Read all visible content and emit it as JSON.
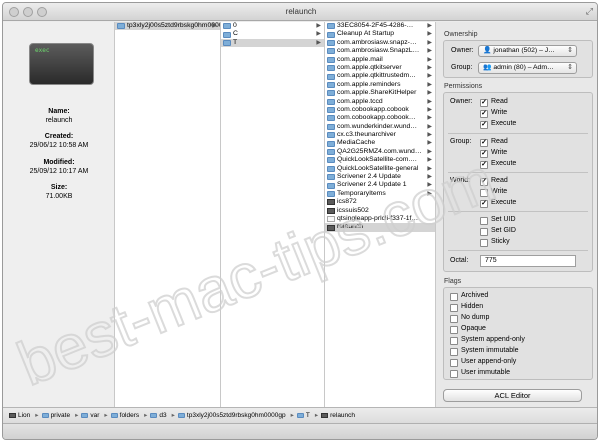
{
  "window": {
    "title": "relaunch"
  },
  "preview": {
    "icon_text": "exec",
    "name_label": "Name:",
    "name": "relaunch",
    "created_label": "Created:",
    "created": "29/06/12 10:58 AM",
    "modified_label": "Modified:",
    "modified": "25/09/12 10:17 AM",
    "size_label": "Size:",
    "size": "71.00KB"
  },
  "columns": {
    "col1": [
      {
        "label": "tp3xly2j00s5ztd9rbskg0hm0000gp",
        "icon": "folder-icon",
        "arrow": true,
        "selected": "gray"
      }
    ],
    "col2": [
      {
        "label": "0",
        "icon": "folder-icon",
        "arrow": true
      },
      {
        "label": "C",
        "icon": "folder-icon",
        "arrow": true
      },
      {
        "label": "T",
        "icon": "folder-icon",
        "arrow": true,
        "selected": "gray"
      }
    ],
    "col3": [
      {
        "label": "33EC8054-2F45-4286-…",
        "icon": "folder-icon",
        "arrow": true
      },
      {
        "label": "Cleanup At Startup",
        "icon": "folder-icon",
        "arrow": true
      },
      {
        "label": "com.ambrosiasw.snapz-…",
        "icon": "folder-icon",
        "arrow": true
      },
      {
        "label": "com.ambrosiasw.SnapzL…",
        "icon": "folder-icon",
        "arrow": true
      },
      {
        "label": "com.apple.mail",
        "icon": "folder-icon",
        "arrow": true
      },
      {
        "label": "com.apple.qtkitserver",
        "icon": "folder-icon",
        "arrow": true
      },
      {
        "label": "com.apple.qtkittrustedm…",
        "icon": "folder-icon",
        "arrow": true
      },
      {
        "label": "com.apple.reminders",
        "icon": "folder-icon",
        "arrow": true
      },
      {
        "label": "com.apple.ShareKitHelper",
        "icon": "folder-icon",
        "arrow": true
      },
      {
        "label": "com.apple.tccd",
        "icon": "folder-icon",
        "arrow": true
      },
      {
        "label": "com.cobookapp.cobook",
        "icon": "folder-icon",
        "arrow": true
      },
      {
        "label": "com.cobookapp.cobook…",
        "icon": "folder-icon",
        "arrow": true
      },
      {
        "label": "com.wunderkinder.wund…",
        "icon": "folder-icon",
        "arrow": true
      },
      {
        "label": "cx.c3.theunarchiver",
        "icon": "folder-icon",
        "arrow": true
      },
      {
        "label": "MediaCache",
        "icon": "folder-icon",
        "arrow": true
      },
      {
        "label": "QA2G25RMZ4.com.wund…",
        "icon": "folder-icon",
        "arrow": true
      },
      {
        "label": "QuickLookSatellite-com.…",
        "icon": "folder-icon",
        "arrow": true
      },
      {
        "label": "QuickLookSatellite-general",
        "icon": "folder-icon",
        "arrow": true
      },
      {
        "label": "Scrivener 2.4 Update",
        "icon": "folder-icon",
        "arrow": true
      },
      {
        "label": "Scrivener 2.4 Update 1",
        "icon": "folder-icon",
        "arrow": true
      },
      {
        "label": "TemporaryItems",
        "icon": "folder-icon",
        "arrow": true
      },
      {
        "label": "ics872",
        "icon": "file-icon",
        "arrow": false
      },
      {
        "label": "icssuis502",
        "icon": "file-icon",
        "arrow": false
      },
      {
        "label": "qtsingleapp-prlcli-f337-1f…",
        "icon": "doc-icon",
        "arrow": false
      },
      {
        "label": "relaunch",
        "icon": "file-icon",
        "arrow": false,
        "selected": "gray"
      }
    ]
  },
  "inspector": {
    "ownership_label": "Ownership",
    "owner_label": "Owner:",
    "owner_value": "jonathan (502) – J…",
    "group_label": "Group:",
    "group_value": "admin (80) – Adm…",
    "permissions_label": "Permissions",
    "owner_perm_label": "Owner:",
    "group_perm_label": "Group:",
    "world_perm_label": "World:",
    "read_label": "Read",
    "write_label": "Write",
    "execute_label": "Execute",
    "owner_perms": {
      "read": true,
      "write": true,
      "execute": true
    },
    "group_perms": {
      "read": true,
      "write": true,
      "execute": true
    },
    "world_perms": {
      "read": true,
      "write": false,
      "execute": true
    },
    "set_uid_label": "Set UID",
    "set_gid_label": "Set GID",
    "sticky_label": "Sticky",
    "octal_label": "Octal:",
    "octal_value": "775",
    "flags_label": "Flags",
    "flags": [
      "Archived",
      "Hidden",
      "No dump",
      "Opaque",
      "System append-only",
      "System immutable",
      "User append-only",
      "User immutable"
    ],
    "acl_button": "ACL Editor"
  },
  "pathbar": [
    {
      "label": "Lion",
      "icon": "disk-icon"
    },
    {
      "label": "private",
      "icon": "folder-icon"
    },
    {
      "label": "var",
      "icon": "folder-icon"
    },
    {
      "label": "folders",
      "icon": "folder-icon"
    },
    {
      "label": "d3",
      "icon": "folder-icon"
    },
    {
      "label": "tp3xly2j00s5ztd9rbskg0hm0000gp",
      "icon": "folder-icon"
    },
    {
      "label": "T",
      "icon": "folder-icon"
    },
    {
      "label": "relaunch",
      "icon": "file-icon"
    }
  ],
  "watermark": "best-mac-tips.com",
  "colors": {
    "folder": "#7eaed8",
    "selection": "#d4d4d4",
    "terminal_green": "#6bd66b"
  }
}
